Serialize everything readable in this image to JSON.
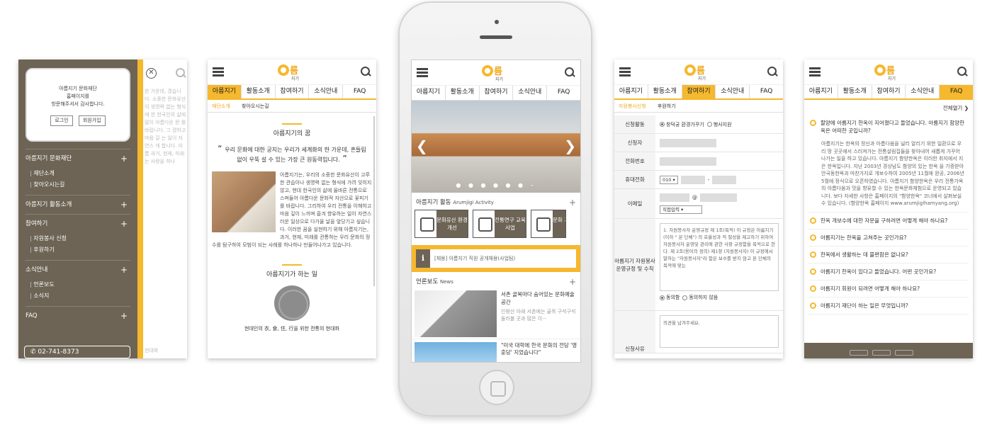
{
  "brand": {
    "logo_main": "름",
    "logo_sub": "지기",
    "accent": "#f5b82e",
    "dark": "#6d6455"
  },
  "nav_tabs": [
    "아름지기",
    "활동소개",
    "참여하기",
    "소식안내",
    "FAQ"
  ],
  "screen1": {
    "welcome_text": [
      "아름지기 문화재단",
      "홈페이지를",
      "방문해주셔서 감사합니다."
    ],
    "login_button": "로그인",
    "join_button": "회원가입",
    "groups": [
      {
        "title": "아름지기 문화재단",
        "items": [
          "재단소개",
          "찾아오시는길"
        ]
      },
      {
        "title": "아름지기 활동소개",
        "items": []
      },
      {
        "title": "참여하기",
        "items": [
          "자원봉사 신청",
          "후원하기"
        ]
      },
      {
        "title": "소식안내",
        "items": [
          "언론보도",
          "소식지"
        ]
      },
      {
        "title": "FAQ",
        "items": []
      }
    ],
    "phone": "02-741-8373",
    "ghost_text": "한 가운데, 겠습니다. 소중한 문화유산이 생명력 없는 형식에 한 한국인의 삶에 많이 아름다운 문 를 바랍니다. 그 겠하고 마음 길 는 일이 자연스 게 합니다. 아름 과거, 현재, 미래 는 사랑을 하나",
    "ghost_bottom": "현대화"
  },
  "screen2": {
    "subtabs": [
      "재단소개",
      "찾아오시는길"
    ],
    "title1": "아름지기의 꿈",
    "quote": "우리 문화에 대한 궁지는 우리가 세계화의 한 가운데, 흔들림 없이 우뚝 설 수 있는 가장 큰 원동력입니다.",
    "para": "아름지기는, 우리의 소중한 문화유산이 고루한 관습이나 생명력 없는 형식에 가려 잊히지 않고, 현대 한국인의 삶에 올바른 전통으로 스며들어 아름다운 문화적 자산으로 꽃피기를 바랍니다. 그리하여 우리 전통을 이해하고 마음 깊이 느끼며 즐겨 향유하는 일이 자연스러운 일상으로 다가올 날을 앞당기고 싶습니다. 이러한 꿈을 실현하기 위해 아름지기는, 과거, 현재, 미래를 관통하는 우리 문화의 정수를 탐구하여 모범이 되는 사례를 하나하나 만들어나가고 있습니다.",
    "title2": "아름지기가 하는 일",
    "caption": "현대인의 衣, 食, 住, 行을 위한 전통의 현대화"
  },
  "screen3": {
    "activity_title": "아름지기 활동",
    "activity_sub": "Arumjigi Activity",
    "activities": [
      "문화유산 환경개선",
      "전통연구 교육사업",
      "문화 기획"
    ],
    "notice": "[채용] 아름지기 직원 공개채용(사업팀)",
    "news_title": "언론보도",
    "news_sub": "News",
    "news": [
      {
        "title": "서촌 골목마다 숨어있는 문화예술공간",
        "desc": "인왕산 아래 서촌에는 골목 구석구석 둘러볼 곳과 많은 이···"
      },
      {
        "title": "\"미국 대학에 한국 문화의 전당 '영훈당' 지었습니다\"",
        "desc": ""
      }
    ]
  },
  "screen4": {
    "subtabs": [
      "자원봉사신청",
      "후원하기"
    ],
    "labels": {
      "activity": "신청활동",
      "name": "신청자",
      "tel": "전화번호",
      "mobile": "휴대전화",
      "email": "이메일",
      "policy": "아름지기 자원봉사 운영규정 및 수칙",
      "comment": "신청사유"
    },
    "activity_options": [
      "창덕궁 환경가꾸기",
      "행사지원"
    ],
    "mobile_prefix": "010",
    "email_at": "@",
    "email_select": "직접입력",
    "policy_text": "1. 자원봉사자 운영규정 제 1조(목적) 이 규정은 아름지기(이하 \" 본 단체\") 의 효율성과 적 절성을 제고하기 위하여 자원봉사자 운영및 관리에 관한 사항 규정함을 목적으로 한다. 제 2조(용어의 정의) 제1항 (자원봉사자) 이 규정에서 말하는 \"자원봉사자\"라 함은 보수를 받지 않고 본 단체의 목적에 맞는",
    "agree": "동의함",
    "disagree": "동의하지 않음",
    "comment_placeholder": "의견을 남겨주세요."
  },
  "screen5": {
    "fold_label": "전체열기",
    "questions": [
      "할양에 아름지기 한옥이 지어졌다고 들었습니다. 아름지기 함양한옥은 어떠한 곳입니까?",
      "한옥 개보수에 대한 자문을 구하려면 어떻게 해야 하나요?",
      "아름지기는 한옥을 고쳐주는 곳인가요?",
      "한옥에서 생활하는 데 불편함은 없나요?",
      "아름지기 한옥이 있다고 들었습니다. 어떤 곳인가요?",
      "아름지기 회원이 되려면 어떻게 해야 하나요?",
      "아름지기 재단이 하는 일은 무엇입니까?"
    ],
    "answer": "아름지기는 한옥의 정신과 아름다움을 널리 알리기 위한 일환으로 우리 땅 곳곳에서 스러져가는 전통살림집들을 찾아내어 새롭게 가꾸어나가는 일을 하고 있습니다. 아름지기 함양한옥은 이러한 취지에서 지은 한옥입니다. 지난 2003년 경상남도 함양의 있는 한옥 을 기증받아 안국동한옥과 마찬가지로 개보수하여 2005년 11월에 완공, 2006년 5월에 정식으로 오픈하였습니다. 아름지기 함양한옥은 우리 전통가옥의 아름다움과 맛을 향유할 수 있는 한옥문화체험으로 운영되고 있습니다. 보다 자세한 사항은 홈페이지의 \"함양한옥\" 코너에서 살펴보실 수 있습니다. (함양한옥 홈페이지 www.arumjigihamyang.org)"
  }
}
